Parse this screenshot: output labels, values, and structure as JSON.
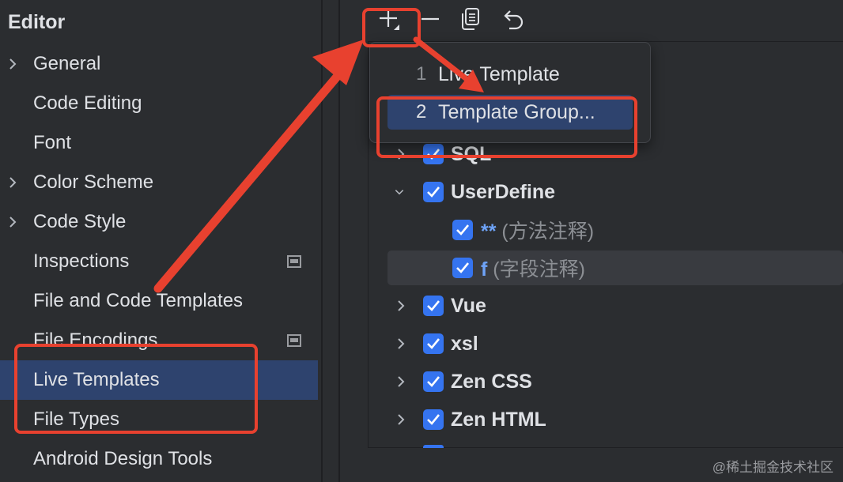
{
  "sidebar": {
    "title": "Editor",
    "items": [
      {
        "label": "General",
        "has_chevron": true
      },
      {
        "label": "Code Editing",
        "has_chevron": false
      },
      {
        "label": "Font",
        "has_chevron": false
      },
      {
        "label": "Color Scheme",
        "has_chevron": true
      },
      {
        "label": "Code Style",
        "has_chevron": true
      },
      {
        "label": "Inspections",
        "has_chevron": false,
        "badge_icon": "project-settings-icon"
      },
      {
        "label": "File and Code Templates",
        "has_chevron": false
      },
      {
        "label": "File Encodings",
        "has_chevron": false,
        "badge_icon": "project-settings-icon"
      },
      {
        "label": "Live Templates",
        "has_chevron": false,
        "selected": true
      },
      {
        "label": "File Types",
        "has_chevron": false
      },
      {
        "label": "Android Design Tools",
        "has_chevron": false
      }
    ]
  },
  "toolbar": {
    "add_icon": "plus-dropdown-icon",
    "remove_icon": "minus-icon",
    "copy_icon": "copy-icon",
    "restore_icon": "undo-icon"
  },
  "popup": {
    "items": [
      {
        "num": "1",
        "label": "Live Template"
      },
      {
        "num": "2",
        "label": "Template Group...",
        "active": true
      }
    ]
  },
  "tree": {
    "rows": [
      {
        "kind": "group",
        "label": "SQL",
        "checked": true,
        "expanded": false
      },
      {
        "kind": "group",
        "label": "UserDefine",
        "checked": true,
        "expanded": true
      },
      {
        "kind": "template",
        "abbreviation": "**",
        "description": "(方法注释)",
        "checked": true
      },
      {
        "kind": "template",
        "abbreviation": "f",
        "description": "(字段注释)",
        "checked": true,
        "selected": true
      },
      {
        "kind": "group",
        "label": "Vue",
        "checked": true,
        "expanded": false
      },
      {
        "kind": "group",
        "label": "xsl",
        "checked": true,
        "expanded": false
      },
      {
        "kind": "group",
        "label": "Zen CSS",
        "checked": true,
        "expanded": false
      },
      {
        "kind": "group",
        "label": "Zen HTML",
        "checked": true,
        "expanded": false
      }
    ]
  },
  "watermark": "@稀土掘金技术社区",
  "colors": {
    "background": "#2b2d30",
    "selection": "#2e436e",
    "checkbox": "#3574f0",
    "annotation_red": "#e8412f"
  }
}
